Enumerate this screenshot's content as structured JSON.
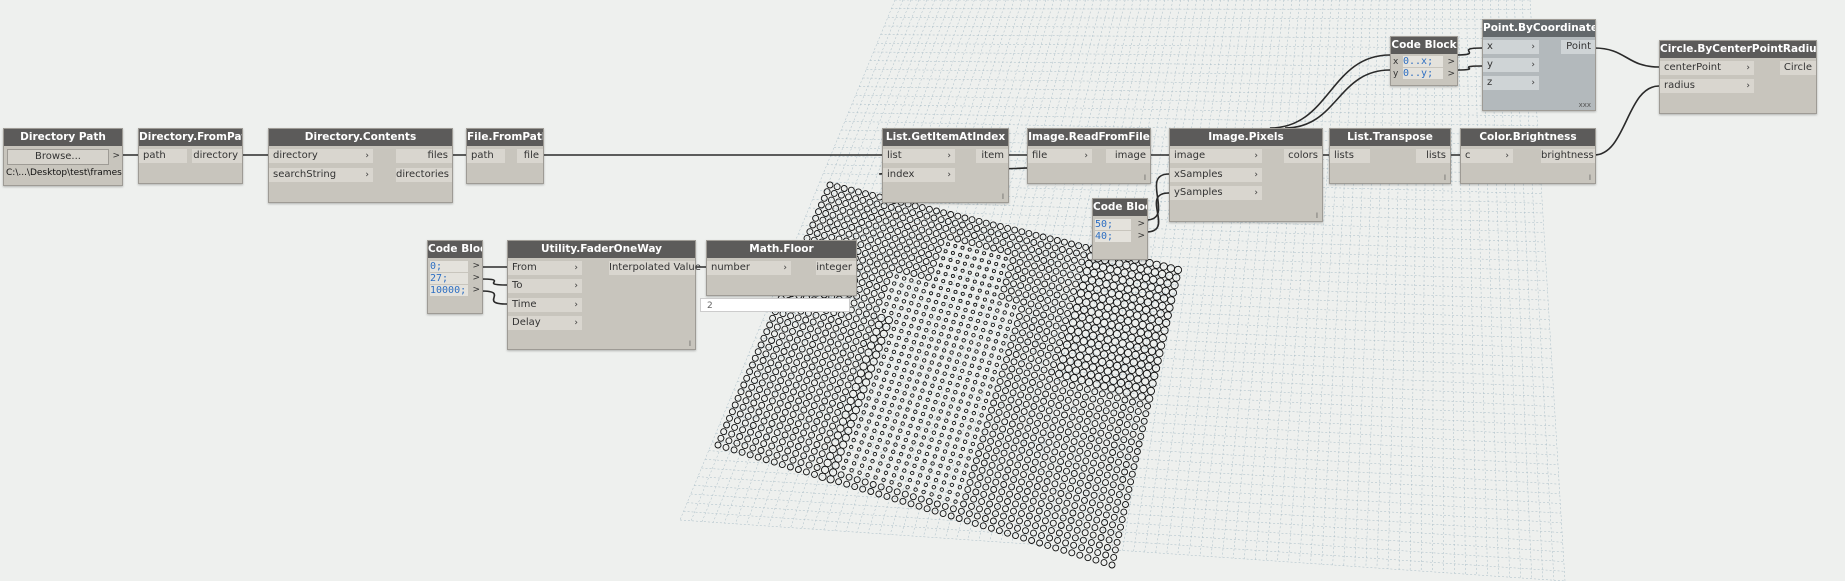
{
  "nodes": {
    "directory_path": {
      "title": "Directory Path",
      "button": "Browse...",
      "out_arrow": ">",
      "path": "C:\\...\\Desktop\\test\\frames"
    },
    "directory_frompath": {
      "title": "Directory.FromPath",
      "in1": "path",
      "out1": "directory"
    },
    "directory_contents": {
      "title": "Directory.Contents",
      "in1": "directory",
      "in2": "searchString",
      "out1": "files",
      "out2": "directories"
    },
    "file_frompath": {
      "title": "File.FromPath",
      "in1": "path",
      "out1": "file"
    },
    "list_getitematindex": {
      "title": "List.GetItemAtIndex",
      "in1": "list",
      "in2": "index",
      "out1": "item"
    },
    "image_readfromfile": {
      "title": "Image.ReadFromFile",
      "in1": "file",
      "out1": "image"
    },
    "image_pixels": {
      "title": "Image.Pixels",
      "in1": "image",
      "in2": "xSamples",
      "in3": "ySamples",
      "out1": "colors"
    },
    "list_transpose": {
      "title": "List.Transpose",
      "in1": "lists",
      "out1": "lists"
    },
    "color_brightness": {
      "title": "Color.Brightness",
      "in1": "c",
      "out1": "brightness"
    },
    "code_block_xy": {
      "title": "Code Block",
      "in1": "x",
      "in2": "y",
      "line1": "0..x;",
      "line2": "0..y;"
    },
    "point_bycoordinates": {
      "title": "Point.ByCoordinates",
      "in1": "x",
      "in2": "y",
      "in3": "z",
      "out1": "Point",
      "corner": "xxx"
    },
    "circle_bycenterpointradius": {
      "title": "Circle.ByCenterPointRadius",
      "in1": "centerPoint",
      "in2": "radius",
      "out1": "Circle"
    },
    "code_block_samples": {
      "title": "Code Block",
      "line1": "50;",
      "line2": "40;"
    },
    "code_block_fader": {
      "title": "Code Block",
      "line1": "0;",
      "line2": "27;",
      "line3": "10000;"
    },
    "utility_faderoneway": {
      "title": "Utility.FaderOneWay",
      "in1": "From",
      "in2": "To",
      "in3": "Time",
      "in4": "Delay",
      "out1": "Interpolated Value"
    },
    "math_floor": {
      "title": "Math.Floor",
      "in1": "number",
      "out1": "integer",
      "preview": "2"
    }
  },
  "glyphs": {
    "arrow_in": "›",
    "arrow_out": ">",
    "lacing": "l"
  },
  "colors": {
    "canvas": "#eef0ee",
    "node_body": "#c8c5bd",
    "node_header": "#5c5b5a",
    "wire": "#2a2a2a",
    "grid": "#a8bcc6",
    "code_text": "#2e6fc2",
    "circle_stroke": "#111111"
  }
}
